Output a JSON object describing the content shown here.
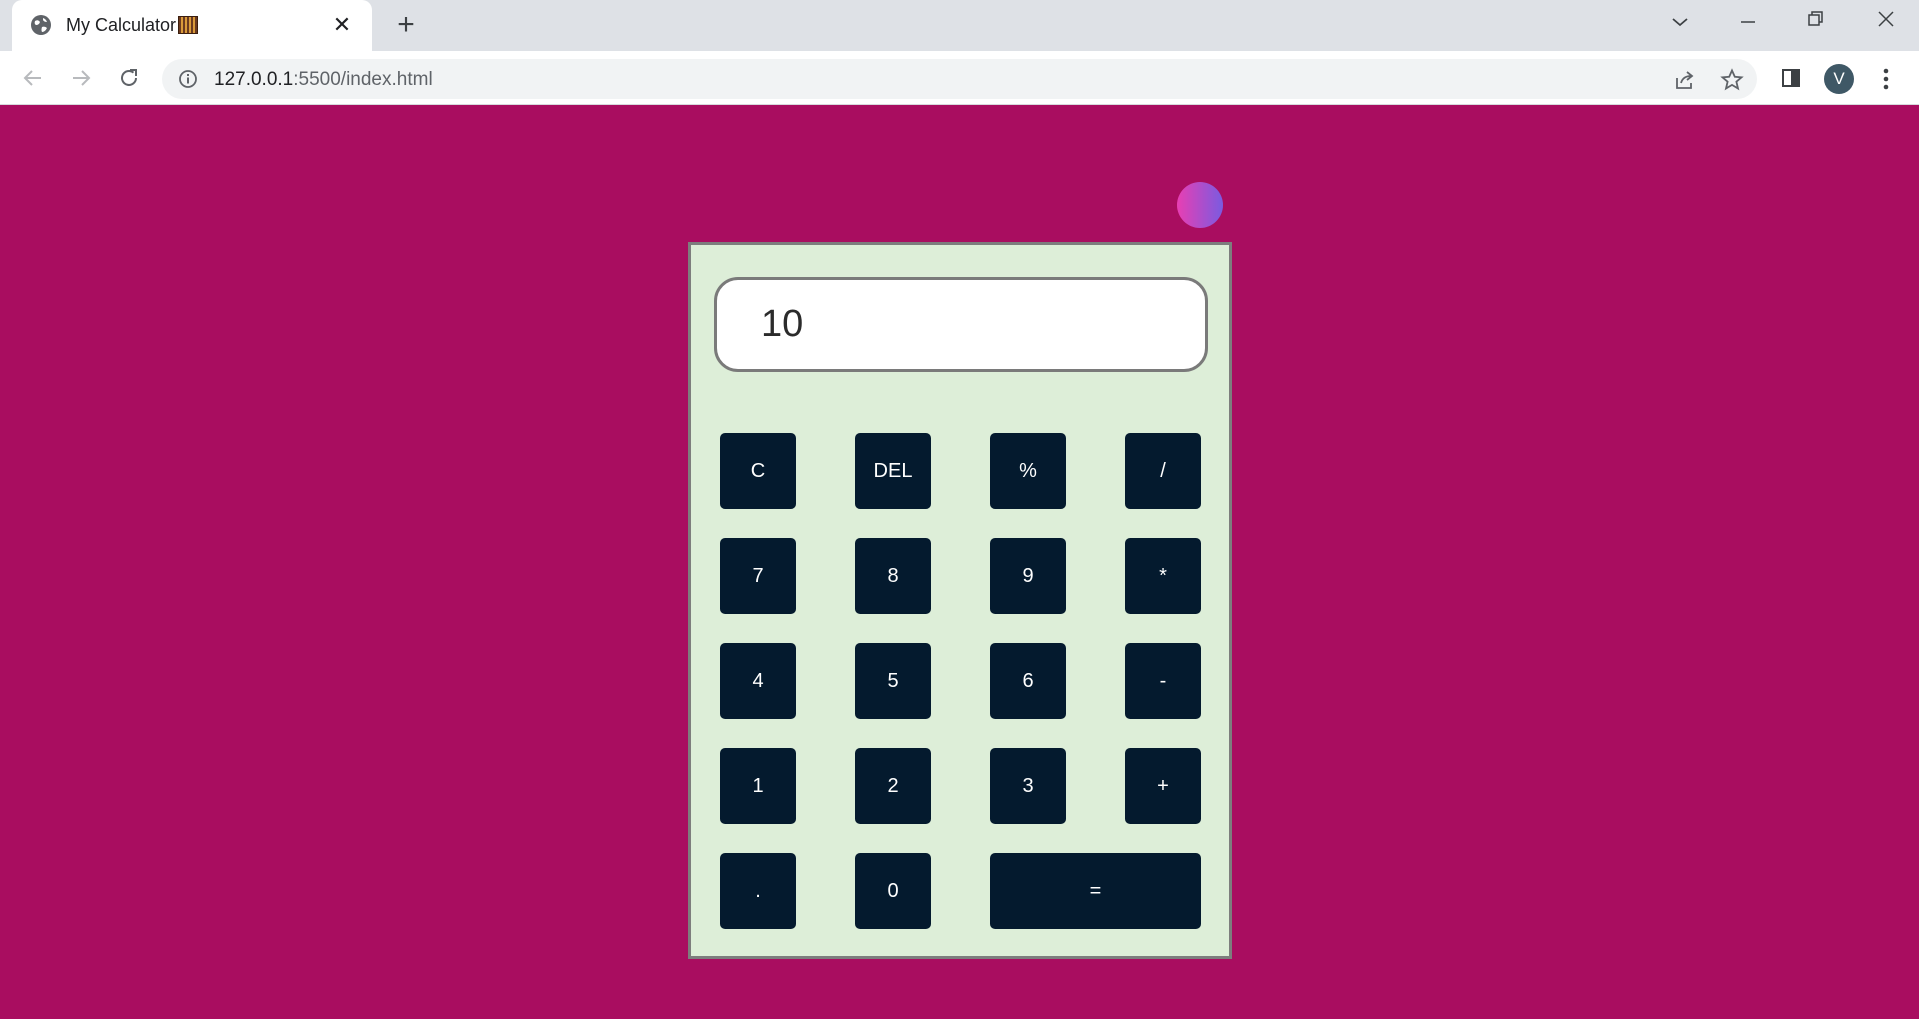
{
  "browser": {
    "tab": {
      "title": "My Calculator",
      "close": "✕"
    },
    "new_tab": "+",
    "address": {
      "host": "127.0.0.1",
      "path": ":5500/index.html"
    },
    "profile_initial": "V",
    "window_controls": {
      "dropdown": "⌵",
      "minimize": "—",
      "restore": "❐",
      "close": "✕"
    }
  },
  "calculator": {
    "display_value": "10",
    "keys": [
      {
        "label": "C",
        "name": "clear-button"
      },
      {
        "label": "DEL",
        "name": "delete-button"
      },
      {
        "label": "%",
        "name": "percent-button"
      },
      {
        "label": "/",
        "name": "divide-button"
      },
      {
        "label": "7",
        "name": "digit-7-button"
      },
      {
        "label": "8",
        "name": "digit-8-button"
      },
      {
        "label": "9",
        "name": "digit-9-button"
      },
      {
        "label": "*",
        "name": "multiply-button"
      },
      {
        "label": "4",
        "name": "digit-4-button"
      },
      {
        "label": "5",
        "name": "digit-5-button"
      },
      {
        "label": "6",
        "name": "digit-6-button"
      },
      {
        "label": "-",
        "name": "subtract-button"
      },
      {
        "label": "1",
        "name": "digit-1-button"
      },
      {
        "label": "2",
        "name": "digit-2-button"
      },
      {
        "label": "3",
        "name": "digit-3-button"
      },
      {
        "label": "+",
        "name": "add-button"
      },
      {
        "label": ".",
        "name": "decimal-button"
      },
      {
        "label": "0",
        "name": "digit-0-button"
      },
      {
        "label": "=",
        "name": "equals-button"
      }
    ]
  },
  "colors": {
    "page_background": "#a90d60",
    "calculator_background": "#ddeed8",
    "key_background": "#041a2e",
    "toggle_gradient_start": "#e83fb3",
    "toggle_gradient_end": "#7a5be0"
  }
}
